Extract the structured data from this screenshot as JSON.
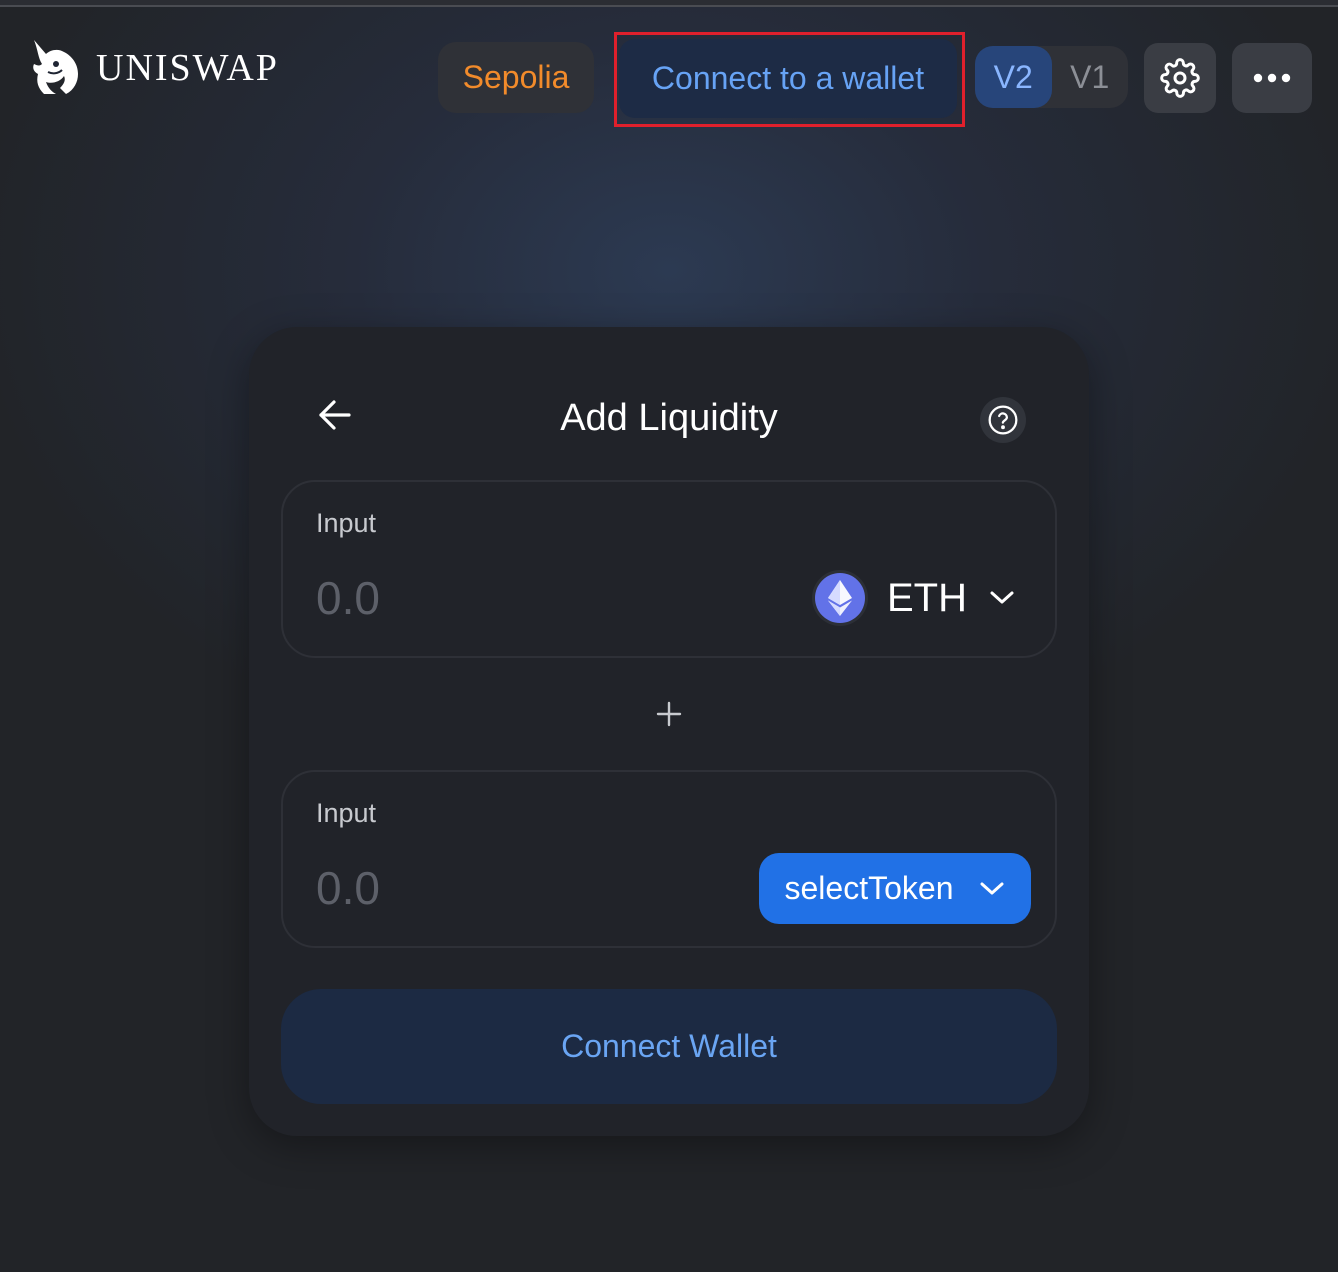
{
  "header": {
    "logo_text": "UNISWAP",
    "network_label": "Sepolia",
    "connect_label": "Connect to a wallet",
    "versions": [
      "V2",
      "V1"
    ],
    "active_version": "V2"
  },
  "card": {
    "title": "Add Liquidity",
    "panels": [
      {
        "label": "Input",
        "placeholder": "0.0",
        "token": "ETH"
      },
      {
        "label": "Input",
        "placeholder": "0.0",
        "select_label": "selectToken"
      }
    ],
    "primary_button": "Connect Wallet"
  },
  "colors": {
    "network": "#f28b2b",
    "accent": "#2171e6",
    "connect_text": "#67a3f5",
    "highlight": "#e0202c"
  },
  "icons": [
    "unicorn-logo-icon",
    "gear-icon",
    "more-dots-icon",
    "back-arrow-icon",
    "help-icon",
    "eth-icon",
    "chevron-down-icon",
    "plus-icon"
  ]
}
